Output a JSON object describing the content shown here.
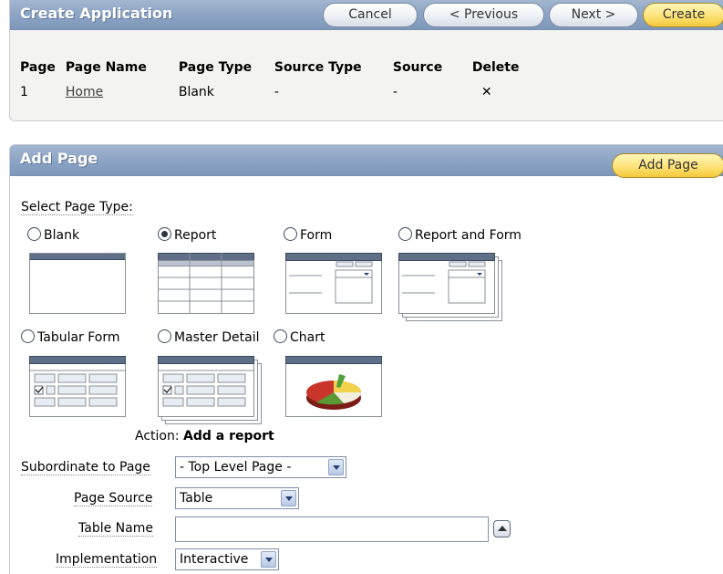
{
  "create_app": {
    "title": "Create Application",
    "buttons": {
      "cancel": "Cancel",
      "previous": "< Previous",
      "next": "Next >",
      "create": "Create"
    },
    "columns": [
      "Page",
      "Page Name",
      "Page Type",
      "Source Type",
      "Source",
      "Delete"
    ],
    "rows": [
      {
        "page": "1",
        "page_name": "Home",
        "page_type": "Blank",
        "source_type": "-",
        "source": "-",
        "delete": "✕"
      }
    ]
  },
  "add_page": {
    "title": "Add Page",
    "add_button": "Add Page",
    "select_label": "Select Page Type:",
    "page_types": [
      {
        "label": "Blank",
        "checked": false
      },
      {
        "label": "Report",
        "checked": true
      },
      {
        "label": "Form",
        "checked": false
      },
      {
        "label": "Report and Form",
        "checked": false
      },
      {
        "label": "Tabular Form",
        "checked": false
      },
      {
        "label": "Master Detail",
        "checked": false
      },
      {
        "label": "Chart",
        "checked": false
      }
    ],
    "action_label": "Action:",
    "action_value": "Add a report",
    "subordinate_label": "Subordinate to Page",
    "subordinate_value": "- Top Level Page -",
    "source_label": "Page Source",
    "source_value": "Table",
    "table_name_label": "Table Name",
    "table_name_value": "",
    "implementation_label": "Implementation",
    "implementation_value": "Interactive"
  },
  "colors": {
    "header_blue": "#8ea6c6",
    "create_yellow": "#fde47e",
    "region_gray": "#f3f3f1"
  },
  "icons": [
    "radio-icon",
    "dropdown-arrow-icon",
    "lov-popup-icon",
    "delete-x-icon"
  ]
}
